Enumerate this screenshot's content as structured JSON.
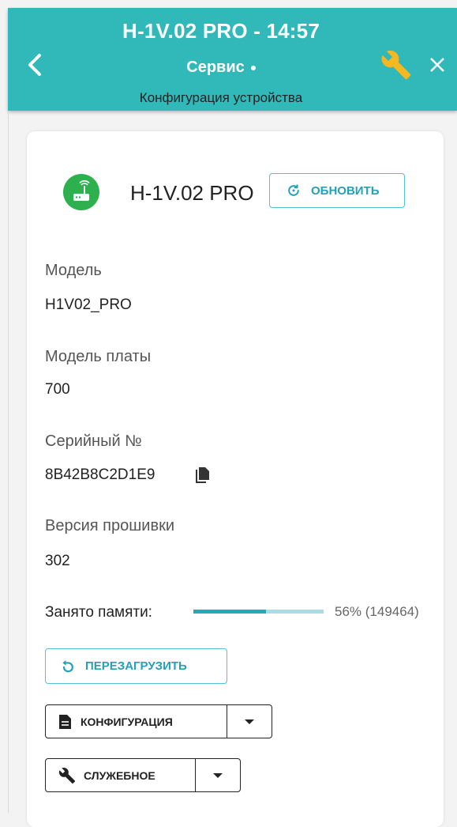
{
  "header": {
    "title": "H-1V.02 PRO  - 14:57",
    "section": "Сервис",
    "subtitle": "Конфигурация устройства",
    "back_icon": "chevron-left-icon",
    "tools_icon": "wrench-icon",
    "close_icon": "close-icon"
  },
  "colors": {
    "accent": "#31b8b8",
    "device_icon_bg": "#2db04d",
    "button_text": "#26a0b4"
  },
  "device": {
    "name": "H-1V.02 PRO",
    "icon": "router-icon",
    "refresh_label": "ОБНОВИТЬ"
  },
  "info": {
    "model_label": "Модель",
    "model_value": "H1V02_PRO",
    "board_label": "Модель платы",
    "board_value": "700",
    "serial_label": "Серийный №",
    "serial_value": "8B42B8C2D1E9",
    "firmware_label": "Версия прошивки",
    "firmware_value": "302"
  },
  "memory": {
    "label": "Занято памяти:",
    "percent_text": "56%  (149464)",
    "fraction": 0.56
  },
  "actions": {
    "reboot_label": "ПЕРЕЗАГРУЗИТЬ",
    "config_label": "КОНФИГУРАЦИЯ",
    "service_label": "СЛУЖЕБНОЕ"
  }
}
